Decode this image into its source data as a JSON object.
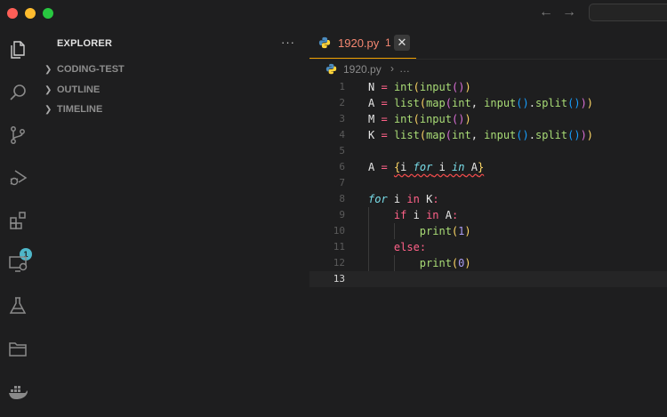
{
  "window": {
    "nav_back": "←",
    "nav_forward": "→"
  },
  "activity_bar": {
    "items": [
      {
        "name": "explorer",
        "icon": "files-icon"
      },
      {
        "name": "search",
        "icon": "search-icon"
      },
      {
        "name": "source-control",
        "icon": "source-control-icon"
      },
      {
        "name": "run-debug",
        "icon": "run-debug-icon"
      },
      {
        "name": "extensions",
        "icon": "extensions-icon",
        "badge": "1"
      },
      {
        "name": "remote-explorer",
        "icon": "remote-explorer-icon"
      },
      {
        "name": "testing",
        "icon": "flask-icon"
      },
      {
        "name": "project-manager",
        "icon": "folder-icon"
      },
      {
        "name": "docker",
        "icon": "docker-icon"
      }
    ]
  },
  "sidebar": {
    "title": "EXPLORER",
    "more": "···",
    "sections": [
      {
        "label": "CODING-TEST"
      },
      {
        "label": "OUTLINE"
      },
      {
        "label": "TIMELINE"
      }
    ]
  },
  "tab": {
    "label": "1920.py",
    "problems": "1",
    "close": "✕"
  },
  "breadcrumbs": {
    "file": "1920.py",
    "separator": "›",
    "more": "…"
  },
  "editor": {
    "line_numbers": [
      "1",
      "2",
      "3",
      "4",
      "5",
      "6",
      "7",
      "8",
      "9",
      "10",
      "11",
      "12",
      "13"
    ],
    "current_line": 13,
    "lines": [
      "N = int(input())",
      "A = list(map(int, input().split()))",
      "M = int(input())",
      "K = list(map(int, input().split()))",
      "",
      "A = {i for i in A}",
      "",
      "for i in K:",
      "    if i in A:",
      "        print(1)",
      "    else:",
      "        print(0)",
      ""
    ]
  },
  "colors": {
    "background": "#1e1e1f",
    "tab_label": "#f48771",
    "badge": "#4fb7c9",
    "keyword": "#ff6188",
    "function": "#a9dc76"
  }
}
